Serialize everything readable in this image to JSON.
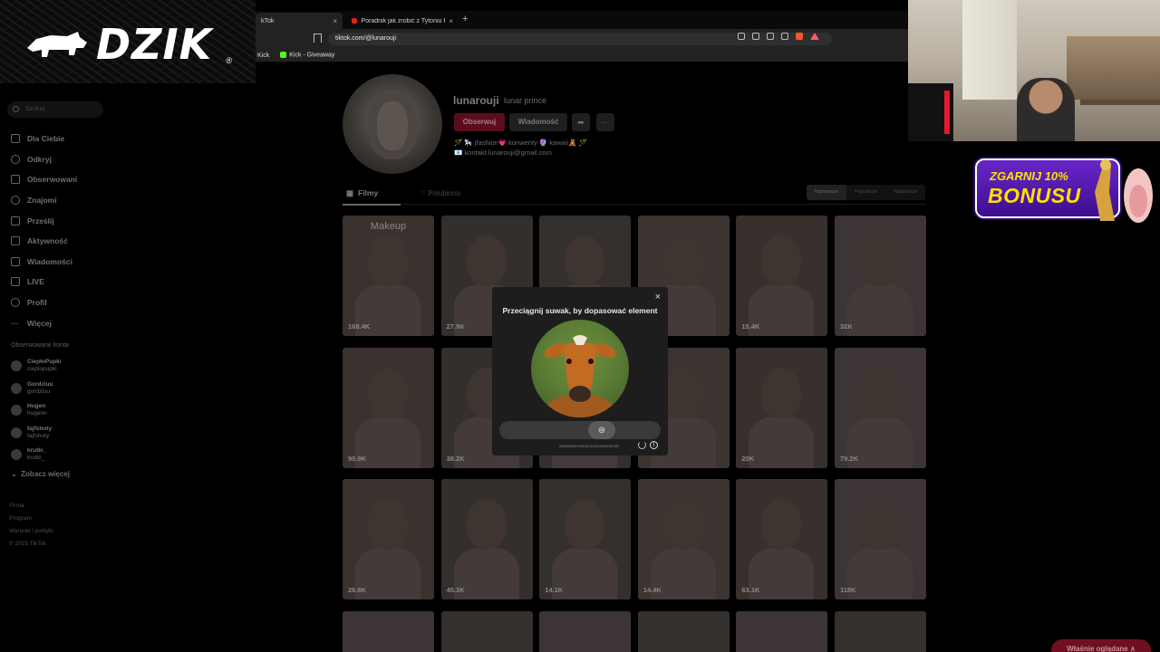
{
  "overlay": {
    "brand": "DZIK",
    "registered": "®"
  },
  "browser": {
    "tabs": [
      {
        "label": "kTok",
        "close": "×"
      },
      {
        "label": "Poradnik jak zrobić z Tytoniu PS czar",
        "close": "×"
      }
    ],
    "new_tab": "+",
    "url": "tiktok.com/@lunarouji",
    "bookmarks": [
      "Kick",
      "Kick - Giveaway"
    ]
  },
  "sidebar": {
    "search_placeholder": "Szukaj",
    "nav": [
      {
        "label": "Dla Ciebie",
        "icon": "home-icon"
      },
      {
        "label": "Odkryj",
        "icon": "compass-icon"
      },
      {
        "label": "Obserwowani",
        "icon": "following-icon"
      },
      {
        "label": "Znajomi",
        "icon": "friends-icon"
      },
      {
        "label": "Prześlij",
        "icon": "upload-icon"
      },
      {
        "label": "Aktywność",
        "icon": "inbox-icon"
      },
      {
        "label": "Wiadomości",
        "icon": "messages-icon"
      },
      {
        "label": "LIVE",
        "icon": "live-icon"
      },
      {
        "label": "Profil",
        "icon": "profile-icon"
      },
      {
        "label": "Więcej",
        "icon": "more-icon"
      }
    ],
    "following_title": "Obserwowane konta",
    "following": [
      {
        "name": "CiepłoPupki",
        "handle": "cieplopupki"
      },
      {
        "name": "Gordziuu",
        "handle": "gordziuu"
      },
      {
        "name": "Hugen",
        "handle": "hugenn"
      },
      {
        "name": "fajfshoty",
        "handle": "fajfshoty"
      },
      {
        "name": "krutki_",
        "handle": "krutki_"
      }
    ],
    "see_more": "Zobacz więcej",
    "footer": [
      "Firma",
      "Program",
      "Warunki i polityki",
      "© 2025 TikTok"
    ]
  },
  "profile": {
    "username": "lunarouji",
    "nickname": "lunar prince",
    "follow_button": "Obserwuj",
    "message_button": "Wiadomość",
    "bio_line1": "🪄 🎠 jfashion💗 konwenty 🔮 kawaii🧸 🪄",
    "bio_line2": "📧 kontakt.lunarouji@gmail.com",
    "tab_videos": "Filmy",
    "tab_liked": "Polubiono",
    "sort_options": [
      "Najnowsze",
      "Popularne",
      "Najstarsze"
    ],
    "videos": [
      {
        "views": "168.4K",
        "caption": "Makeup"
      },
      {
        "views": "27.9K"
      },
      {
        "views": ""
      },
      {
        "views": ""
      },
      {
        "views": "15.4K"
      },
      {
        "views": "32K"
      },
      {
        "views": "90.9K"
      },
      {
        "views": "38.2K"
      },
      {
        "views": ""
      },
      {
        "views": ""
      },
      {
        "views": "20K"
      },
      {
        "views": "79.2K"
      },
      {
        "views": "26.8K"
      },
      {
        "views": "45.3K"
      },
      {
        "views": "14.1K"
      },
      {
        "views": "14.4K"
      },
      {
        "views": "63.1K"
      },
      {
        "views": "118K"
      }
    ]
  },
  "captcha": {
    "title": "Przeciągnij suwak, by dopasować element",
    "close": "×",
    "id_text": "2650695251992823516423149992337380",
    "slider_progress": 0.66,
    "info": "!"
  },
  "bonus": {
    "line1": "ZGARNIJ 10%",
    "line2": "BONUSU"
  },
  "watch_now": "Właśnie oglądane ∧",
  "colors": {
    "tiktok_red": "#fe2c55",
    "bonus_purple": "#5a1bb5",
    "bonus_yellow": "#ffe100"
  }
}
